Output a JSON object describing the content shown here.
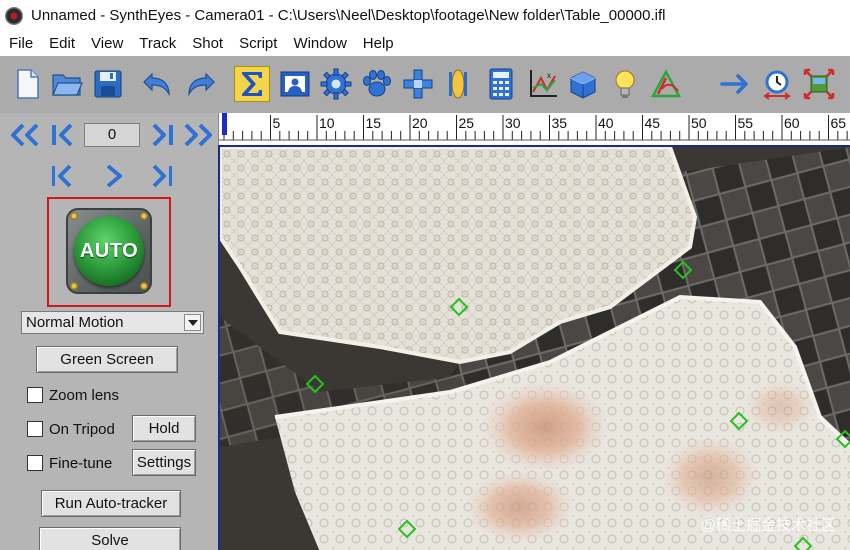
{
  "window": {
    "title": "Unnamed - SynthEyes - Camera01 - C:\\Users\\Neel\\Desktop\\footage\\New folder\\Table_00000.ifl"
  },
  "menu": [
    "File",
    "Edit",
    "View",
    "Track",
    "Shot",
    "Script",
    "Window",
    "Help"
  ],
  "toolbar": {
    "buttons": [
      {
        "name": "new-file-icon"
      },
      {
        "name": "open-folder-icon"
      },
      {
        "name": "save-icon"
      },
      {
        "name": "undo-icon"
      },
      {
        "name": "redo-icon"
      },
      {
        "name": "summary-sigma-icon",
        "selected": true
      },
      {
        "name": "camera-view-icon"
      },
      {
        "name": "gear-solver-icon"
      },
      {
        "name": "paw-tracker-icon"
      },
      {
        "name": "coordinate-axis-icon"
      },
      {
        "name": "lens-icon"
      },
      {
        "name": "calculator-icon"
      },
      {
        "name": "graph-editor-icon"
      },
      {
        "name": "3d-cube-icon"
      },
      {
        "name": "lightbulb-icon"
      },
      {
        "name": "phase-icon"
      },
      {
        "name": "arrow-right-icon"
      },
      {
        "name": "timer-icon"
      },
      {
        "name": "fit-view-icon"
      }
    ],
    "accent": "#f4d54a"
  },
  "transport": {
    "frame_value": "0",
    "icons": [
      "rewind-start-icon",
      "step-back-key-icon",
      "step-forward-key-icon",
      "fast-forward-end-icon",
      "previous-frame-icon",
      "play-icon",
      "next-frame-icon"
    ]
  },
  "auto_panel": {
    "auto_label": "AUTO",
    "highlight_color": "#d01818"
  },
  "motion_select": {
    "value": "Normal Motion"
  },
  "buttons": {
    "green_screen": "Green Screen",
    "hold": "Hold",
    "settings": "Settings",
    "run_auto_tracker": "Run Auto-tracker",
    "solve": "Solve"
  },
  "checkboxes": {
    "zoom_lens": {
      "label": "Zoom lens",
      "checked": false
    },
    "on_tripod": {
      "label": "On Tripod",
      "checked": false
    },
    "fine_tune": {
      "label": "Fine-tune",
      "checked": false
    }
  },
  "timeline": {
    "labels": [
      "5",
      "10",
      "15",
      "20",
      "25",
      "30",
      "35",
      "40",
      "45",
      "50",
      "55",
      "60",
      "65"
    ],
    "current_frame": 0
  },
  "viewport": {
    "tracker_color": "#27c21e",
    "tracker_count": 7
  },
  "watermark": "@稀土掘金技术社区"
}
